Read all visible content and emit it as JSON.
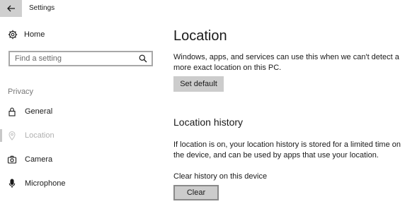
{
  "window": {
    "title": "Settings",
    "back_icon": "arrow-left-icon"
  },
  "sidebar": {
    "home_label": "Home",
    "search_placeholder": "Find a setting",
    "section_label": "Privacy",
    "items": [
      {
        "label": "General",
        "icon": "lock-icon",
        "active": false
      },
      {
        "label": "Location",
        "icon": "location-pin-icon",
        "active": true
      },
      {
        "label": "Camera",
        "icon": "camera-icon",
        "active": false
      },
      {
        "label": "Microphone",
        "icon": "microphone-icon",
        "active": false
      }
    ]
  },
  "main": {
    "title": "Location",
    "default_text": "Windows, apps, and services can use this when we can't detect a more exact location on this PC.",
    "set_default_label": "Set default",
    "history_heading": "Location history",
    "history_text": "If location is on, your location history is stored for a limited time on the device, and can be used by apps that use your location.",
    "clear_history_label": "Clear history on this device",
    "clear_button_label": "Clear"
  },
  "colors": {
    "button_bg": "#cccccc",
    "active_item_text": "#b0b0b0",
    "back_button_bg": "#cfcfcf"
  }
}
